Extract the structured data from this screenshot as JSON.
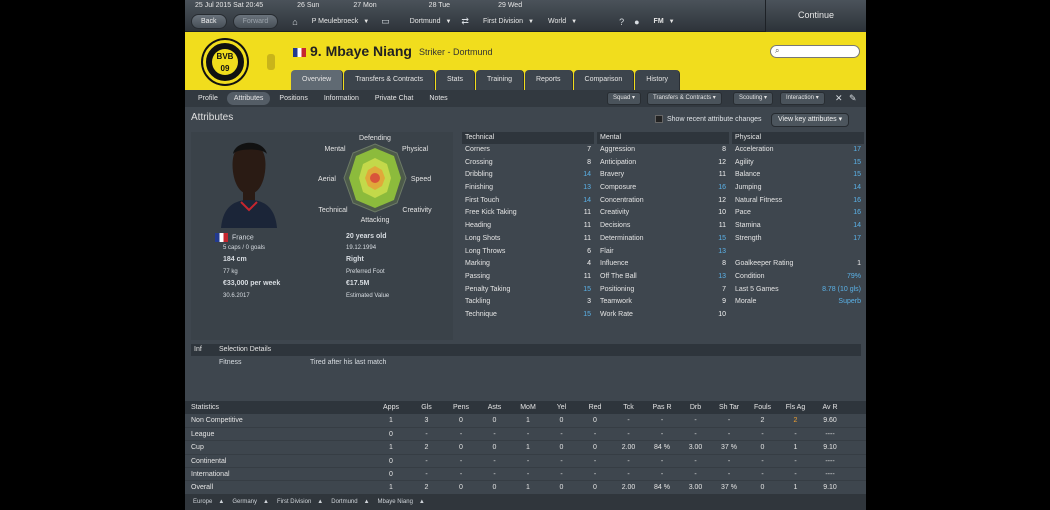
{
  "topbar": {
    "calendar": [
      {
        "label": "25 Jul 2015  Sat  20:45"
      },
      {
        "label": "26 Sun"
      },
      {
        "label": "27 Mon"
      },
      {
        "label": "28 Tue"
      },
      {
        "label": "29 Wed"
      }
    ],
    "back_label": "Back",
    "forward_label": "Forward",
    "manager": "P Meulebroeck",
    "team": "Dortmund",
    "division": "First Division",
    "world": "World",
    "fm_menu": "FM",
    "continue_label": "Continue"
  },
  "player": {
    "club_badge_text": "BVB 09",
    "name": "9. Mbaye Niang",
    "position": "Striker - Dortmund"
  },
  "tabs": [
    "Overview",
    "Transfers & Contracts",
    "Stats",
    "Training",
    "Reports",
    "Comparison",
    "History"
  ],
  "subtabs": [
    "Profile",
    "Attributes",
    "Positions",
    "Information",
    "Private Chat",
    "Notes"
  ],
  "dropdowns": [
    "Squad",
    "Transfers & Contracts",
    "Scouting",
    "Interaction"
  ],
  "attributes": {
    "title": "Attributes",
    "show_recent": "Show recent attribute changes",
    "view_key": "View key attributes",
    "radar": {
      "defending": "Defending",
      "mental": "Mental",
      "physical": "Physical",
      "aerial": "Aerial",
      "speed": "Speed",
      "technical": "Technical",
      "creativity": "Creativity",
      "attacking": "Attacking"
    },
    "profile": {
      "nationality": "France",
      "caps": "5 caps / 0 goals",
      "height": "184 cm",
      "weight": "77 kg",
      "wage": "€33,000 per week",
      "contract": "30.6.2017",
      "age": "20 years old",
      "dob": "19.12.1994",
      "foot": "Right",
      "foot_label": "Preferred Foot",
      "value": "€17.5M",
      "value_label": "Estimated Value"
    },
    "technical": {
      "head": "Technical",
      "rows": [
        {
          "n": "Corners",
          "v": "7"
        },
        {
          "n": "Crossing",
          "v": "8"
        },
        {
          "n": "Dribbling",
          "v": "14"
        },
        {
          "n": "Finishing",
          "v": "13"
        },
        {
          "n": "First Touch",
          "v": "14"
        },
        {
          "n": "Free Kick Taking",
          "v": "11"
        },
        {
          "n": "Heading",
          "v": "11"
        },
        {
          "n": "Long Shots",
          "v": "11"
        },
        {
          "n": "Long Throws",
          "v": "6"
        },
        {
          "n": "Marking",
          "v": "4"
        },
        {
          "n": "Passing",
          "v": "11"
        },
        {
          "n": "Penalty Taking",
          "v": "15"
        },
        {
          "n": "Tackling",
          "v": "3"
        },
        {
          "n": "Technique",
          "v": "15"
        }
      ]
    },
    "mental": {
      "head": "Mental",
      "rows": [
        {
          "n": "Aggression",
          "v": "8"
        },
        {
          "n": "Anticipation",
          "v": "12"
        },
        {
          "n": "Bravery",
          "v": "11"
        },
        {
          "n": "Composure",
          "v": "16"
        },
        {
          "n": "Concentration",
          "v": "12"
        },
        {
          "n": "Creativity",
          "v": "10"
        },
        {
          "n": "Decisions",
          "v": "11"
        },
        {
          "n": "Determination",
          "v": "15"
        },
        {
          "n": "Flair",
          "v": "13"
        },
        {
          "n": "Influence",
          "v": "8"
        },
        {
          "n": "Off The Ball",
          "v": "13"
        },
        {
          "n": "Positioning",
          "v": "7"
        },
        {
          "n": "Teamwork",
          "v": "9"
        },
        {
          "n": "Work Rate",
          "v": "10"
        }
      ]
    },
    "physical": {
      "head": "Physical",
      "rows": [
        {
          "n": "Acceleration",
          "v": "17"
        },
        {
          "n": "Agility",
          "v": "15"
        },
        {
          "n": "Balance",
          "v": "15"
        },
        {
          "n": "Jumping",
          "v": "14"
        },
        {
          "n": "Natural Fitness",
          "v": "16"
        },
        {
          "n": "Pace",
          "v": "16"
        },
        {
          "n": "Stamina",
          "v": "14"
        },
        {
          "n": "Strength",
          "v": "17"
        }
      ],
      "extra": [
        {
          "n": "Goalkeeper Rating",
          "v": "1"
        },
        {
          "n": "Condition",
          "v": "79%"
        },
        {
          "n": "Last 5 Games",
          "v": "8.78 (10 gls)"
        },
        {
          "n": "Morale",
          "v": "Superb"
        }
      ]
    }
  },
  "info": {
    "col_inf": "Inf",
    "col_sel": "Selection Details",
    "fitness_label": "Fitness",
    "fitness_value": "Tired after his last match"
  },
  "statistics": {
    "headers": [
      "Statistics",
      "Apps",
      "Gls",
      "Pens",
      "Asts",
      "MoM",
      "Yel",
      "Red",
      "Tck",
      "Pas R",
      "Drb",
      "Sh Tar",
      "Fouls",
      "Fls Ag",
      "Av R"
    ],
    "rows": [
      [
        "Non Competitive",
        "1",
        "3",
        "0",
        "0",
        "1",
        "0",
        "0",
        "-",
        "-",
        "-",
        "-",
        "2",
        "2",
        "9.60"
      ],
      [
        "League",
        "0",
        "-",
        "-",
        "-",
        "-",
        "-",
        "-",
        "-",
        "-",
        "-",
        "-",
        "-",
        "-",
        "----"
      ],
      [
        "Cup",
        "1",
        "2",
        "0",
        "0",
        "1",
        "0",
        "0",
        "2.00",
        "84 %",
        "3.00",
        "37 %",
        "0",
        "1",
        "9.10"
      ],
      [
        "Continental",
        "0",
        "-",
        "-",
        "-",
        "-",
        "-",
        "-",
        "-",
        "-",
        "-",
        "-",
        "-",
        "-",
        "----"
      ],
      [
        "International",
        "0",
        "-",
        "-",
        "-",
        "-",
        "-",
        "-",
        "-",
        "-",
        "-",
        "-",
        "-",
        "-",
        "----"
      ],
      [
        "Overall",
        "1",
        "2",
        "0",
        "0",
        "1",
        "0",
        "0",
        "2.00",
        "84 %",
        "3.00",
        "37 %",
        "0",
        "1",
        "9.10"
      ]
    ]
  },
  "footer": [
    "Europe",
    "Germany",
    "First Division",
    "Dortmund",
    "Mbaye Niang"
  ],
  "colors": {
    "club_yellow": "#f1dd1d",
    "value_blue": "#5bb2e8",
    "fls_ag_orange": "#f0a030"
  }
}
